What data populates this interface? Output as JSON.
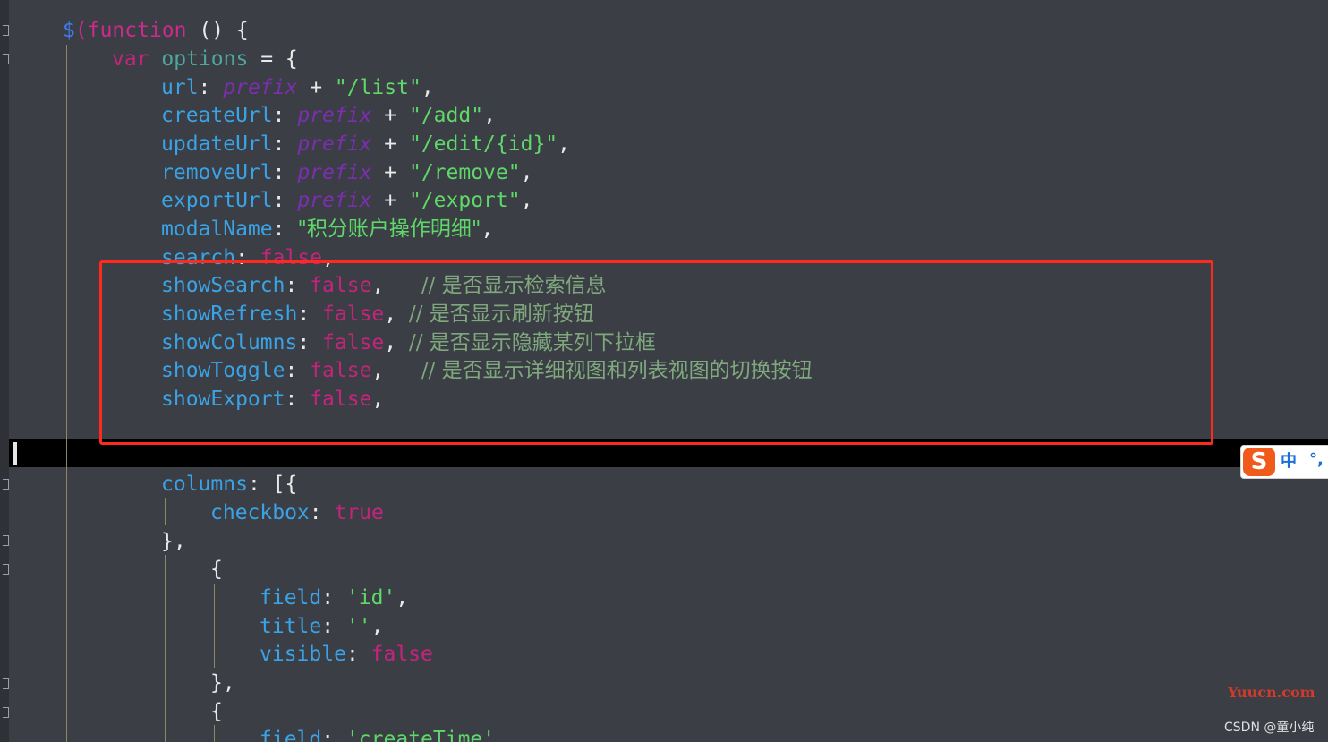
{
  "code": {
    "l1": {
      "dollar": "$",
      "paren_open": "(",
      "function_kw": "function",
      "rest": " () {"
    },
    "l2": {
      "var_kw": "var",
      "name": "options",
      "rest": " = {"
    },
    "l3": {
      "key": "url",
      "colon": ": ",
      "prefix": "prefix",
      "plus": " + ",
      "str": "\"/list\"",
      "tail": ","
    },
    "l4": {
      "key": "createUrl",
      "colon": ": ",
      "prefix": "prefix",
      "plus": " + ",
      "str": "\"/add\"",
      "tail": ","
    },
    "l5": {
      "key": "updateUrl",
      "colon": ": ",
      "prefix": "prefix",
      "plus": " + ",
      "str": "\"/edit/{id}\"",
      "tail": ","
    },
    "l6": {
      "key": "removeUrl",
      "colon": ": ",
      "prefix": "prefix",
      "plus": " + ",
      "str": "\"/remove\"",
      "tail": ","
    },
    "l7": {
      "key": "exportUrl",
      "colon": ": ",
      "prefix": "prefix",
      "plus": " + ",
      "str": "\"/export\"",
      "tail": ","
    },
    "l8": {
      "key": "modalName",
      "colon": ": ",
      "str": "\"积分账户操作明细\"",
      "tail": ","
    },
    "l9": {
      "key": "search",
      "colon": ": ",
      "val": "false",
      "tail": ","
    },
    "l10": {
      "key": "showSearch",
      "colon": ": ",
      "val": "false",
      "tail": ",   ",
      "comment": "// 是否显示检索信息"
    },
    "l11": {
      "key": "showRefresh",
      "colon": ": ",
      "val": "false",
      "tail": ", ",
      "comment": "// 是否显示刷新按钮"
    },
    "l12": {
      "key": "showColumns",
      "colon": ": ",
      "val": "false",
      "tail": ", ",
      "comment": "// 是否显示隐藏某列下拉框"
    },
    "l13": {
      "key": "showToggle",
      "colon": ": ",
      "val": "false",
      "tail": ",   ",
      "comment": "// 是否显示详细视图和列表视图的切换按钮"
    },
    "l14": {
      "key": "showExport",
      "colon": ": ",
      "val": "false",
      "tail": ","
    },
    "l15": {
      "key": "columns",
      "colon": ": ",
      "tail": "[{"
    },
    "l16": {
      "key": "checkbox",
      "colon": ": ",
      "val": "true"
    },
    "l17": {
      "text": "},"
    },
    "l18": {
      "text": "{"
    },
    "l19": {
      "key": "field",
      "colon": ": ",
      "str": "'id'",
      "tail": ","
    },
    "l20": {
      "key": "title",
      "colon": ": ",
      "str": "''",
      "tail": ","
    },
    "l21": {
      "key": "visible",
      "colon": ": ",
      "val": "false"
    },
    "l22": {
      "text": "},"
    },
    "l23": {
      "text": "{"
    },
    "l24": {
      "key": "field",
      "colon": ": ",
      "str": "'createTime'",
      "tail": ","
    }
  },
  "ime": {
    "logo": "S",
    "mode": "中",
    "punct": "°,"
  },
  "watermarks": {
    "yuucn": "Yuucn.com",
    "csdn": "CSDN @童小纯"
  },
  "colors": {
    "background": "#3b3e44",
    "keyword": "#c5247c",
    "property": "#3aa3e6",
    "string": "#5fd86a",
    "comment": "#7fa87e",
    "highlight_border": "#ff2a1e"
  }
}
